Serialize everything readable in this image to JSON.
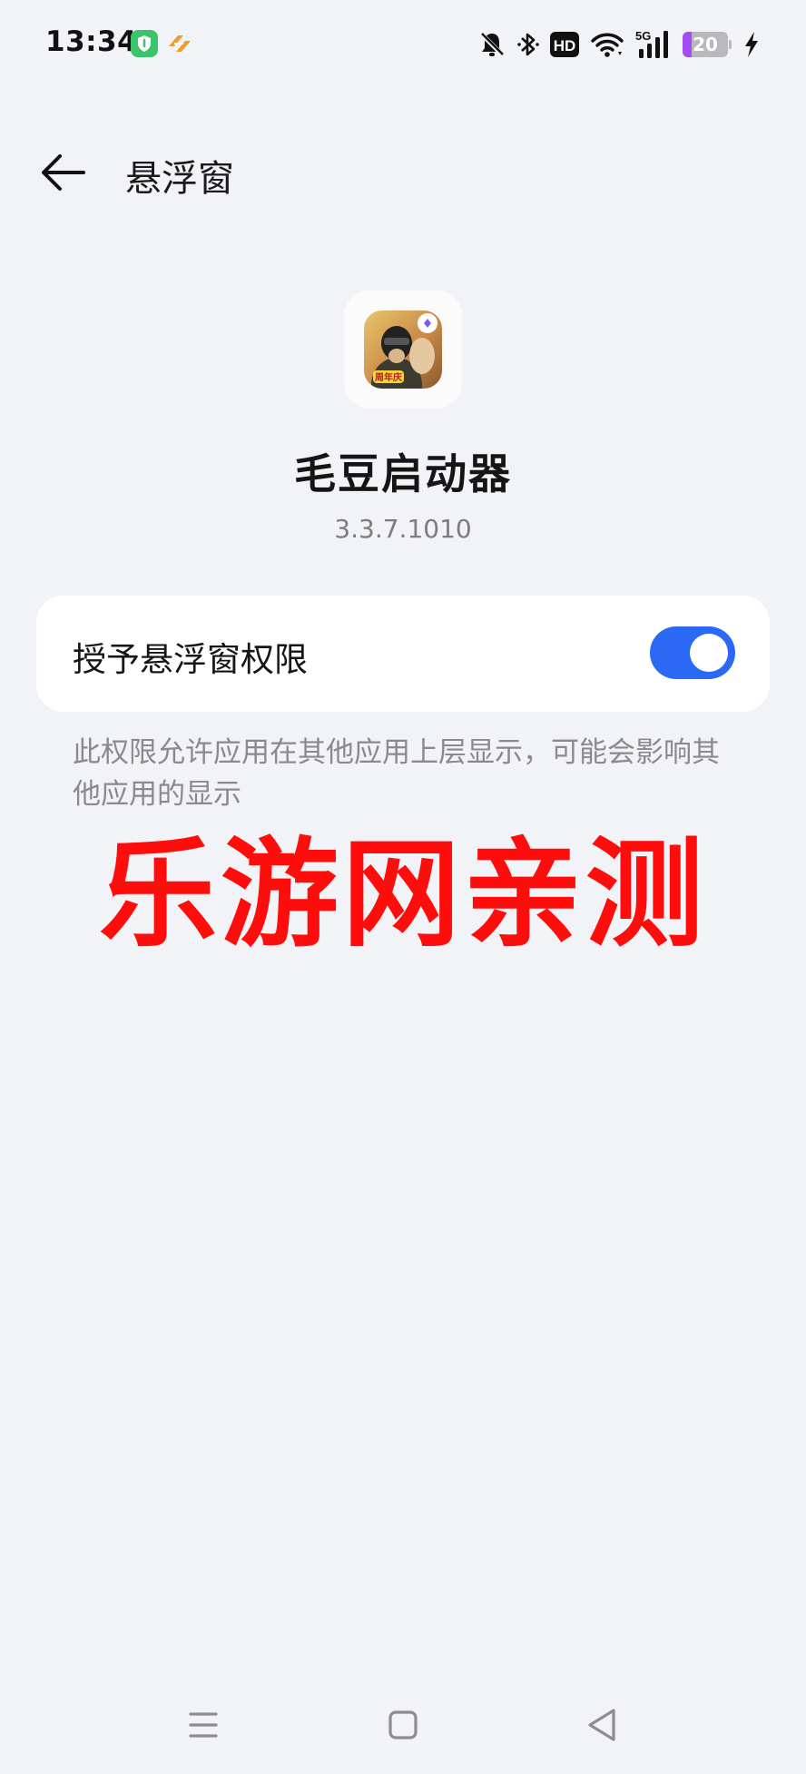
{
  "status_bar": {
    "time": "13:34",
    "battery_level": "20",
    "battery_fraction": 0.2,
    "icons": [
      "security-shield-icon",
      "orange-app-icon",
      "mute-bell-icon",
      "bluetooth-icon",
      "hd-icon",
      "wifi-icon",
      "signal-5g-icon",
      "battery-icon",
      "charging-icon"
    ],
    "hd_label": "HD",
    "network_label": "5G"
  },
  "header": {
    "title": "悬浮窗",
    "back_icon": "arrow-left-icon"
  },
  "app": {
    "name": "毛豆启动器",
    "version": "3.3.7.1010",
    "logo_badge_text": "周年庆"
  },
  "permission": {
    "label": "授予悬浮窗权限",
    "enabled": true,
    "description": "此权限允许应用在其他应用上层显示，可能会影响其他应用的显示"
  },
  "watermark": {
    "text": "乐游网亲测"
  },
  "nav_bar": {
    "icons": [
      "menu-lines-icon",
      "home-square-icon",
      "back-triangle-icon"
    ]
  },
  "colors": {
    "background": "#f2f3f6",
    "toggle_on": "#2b68f3",
    "watermark": "#ff0d0d",
    "battery_fill": "#a44cf4"
  }
}
